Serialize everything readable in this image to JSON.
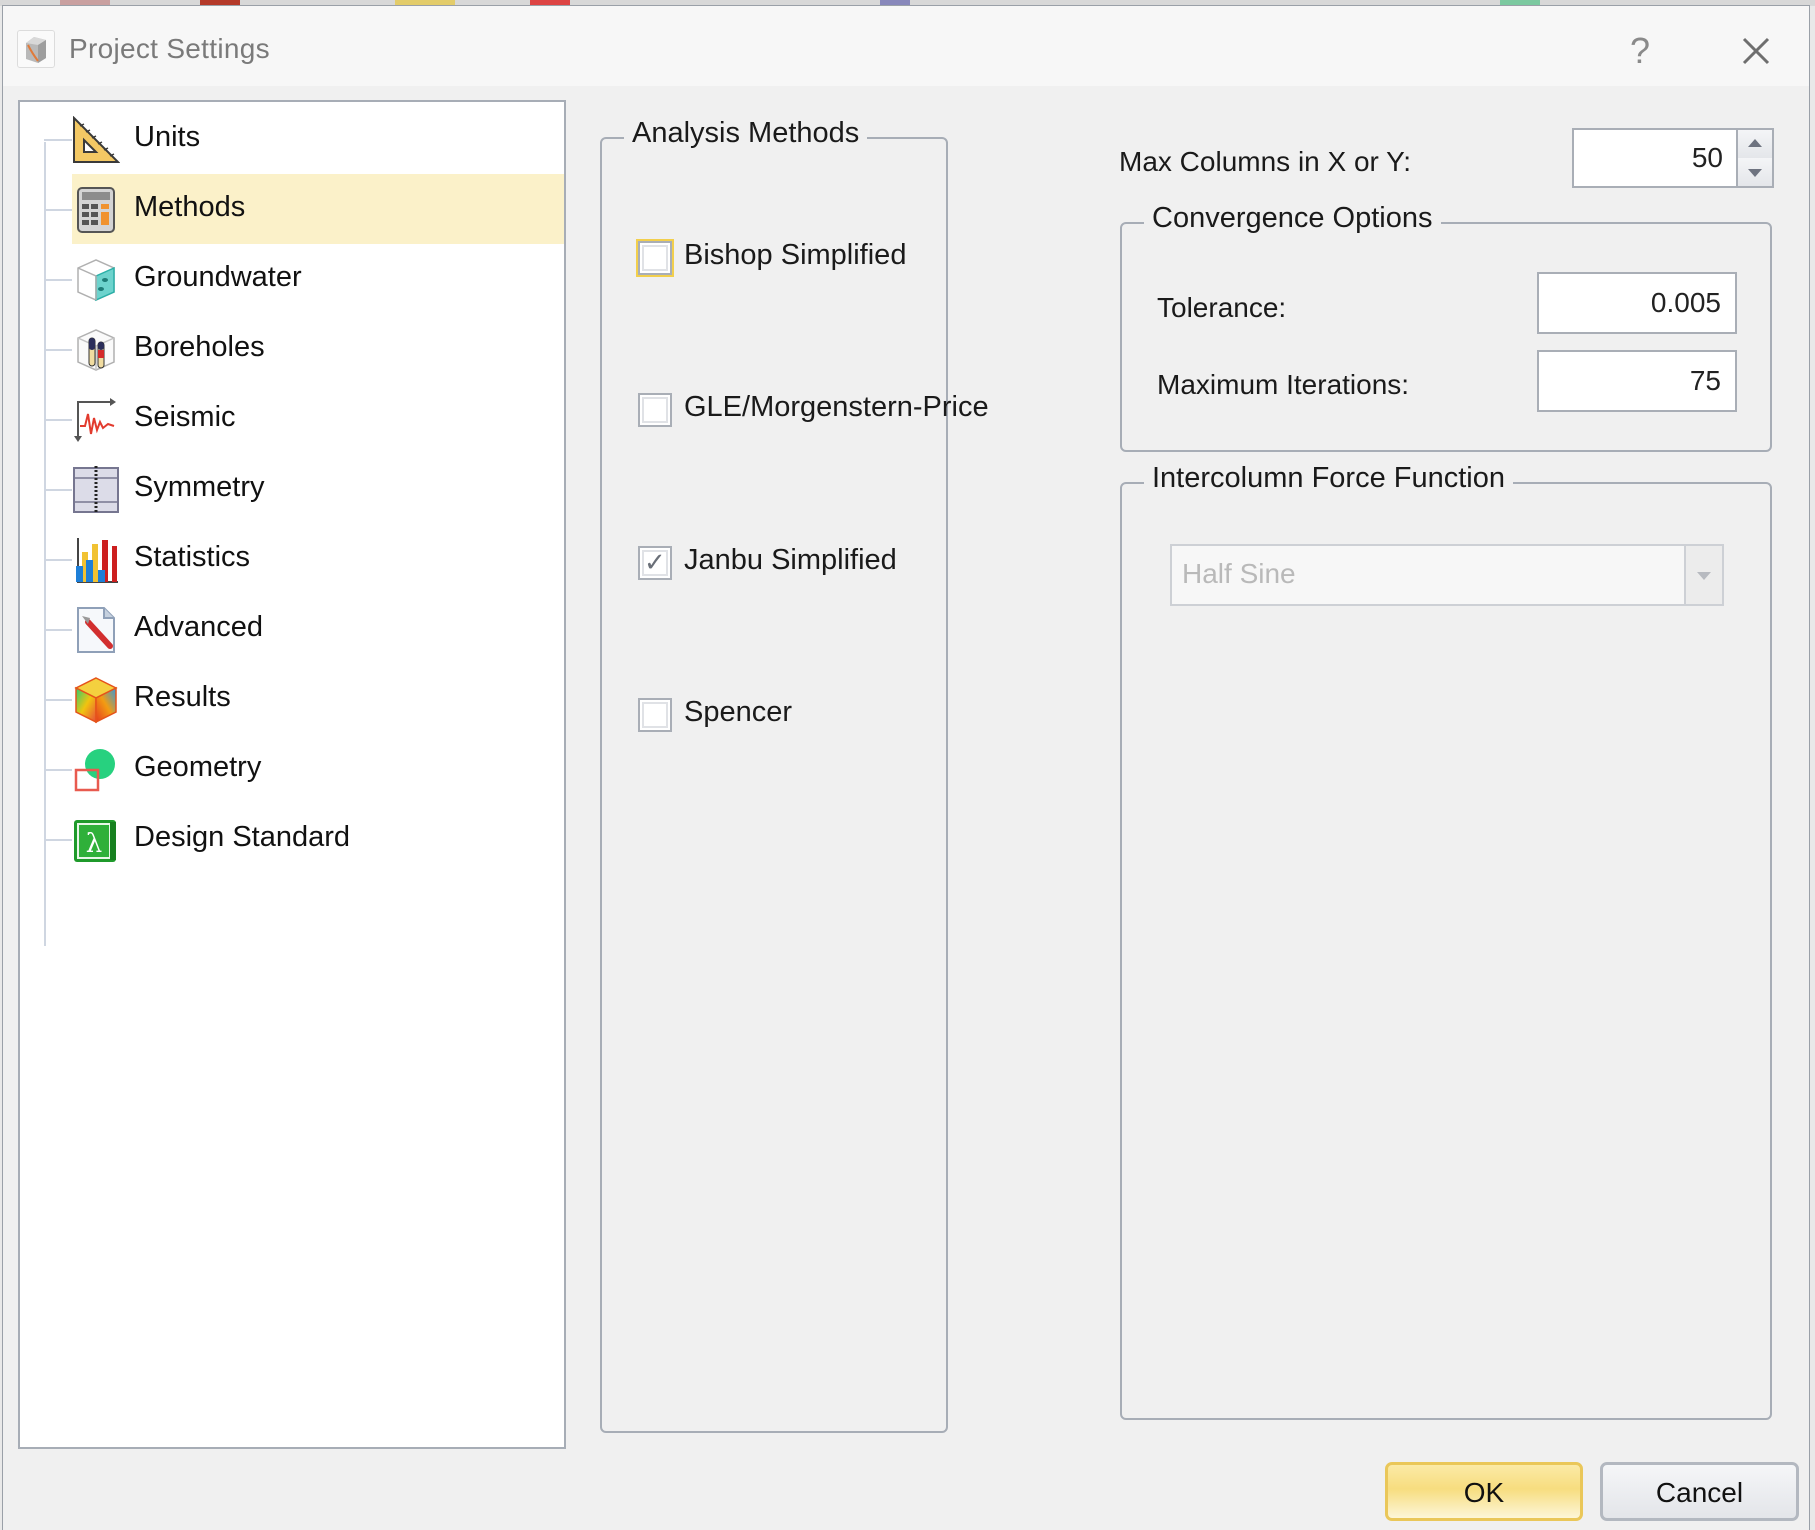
{
  "window": {
    "title": "Project Settings",
    "help_label": "?",
    "icons": {
      "app": "project-settings-icon",
      "help": "help-icon",
      "close": "close-icon"
    }
  },
  "sidebar": {
    "selected": "Methods",
    "items": [
      {
        "label": "Units",
        "icon": "set-square-ruler-icon"
      },
      {
        "label": "Methods",
        "icon": "calculator-icon"
      },
      {
        "label": "Groundwater",
        "icon": "water-cube-icon"
      },
      {
        "label": "Boreholes",
        "icon": "borehole-cube-icon"
      },
      {
        "label": "Seismic",
        "icon": "seismic-wave-icon"
      },
      {
        "label": "Symmetry",
        "icon": "symmetry-icon"
      },
      {
        "label": "Statistics",
        "icon": "bar-chart-icon"
      },
      {
        "label": "Advanced",
        "icon": "wrench-document-icon"
      },
      {
        "label": "Results",
        "icon": "results-cube-icon"
      },
      {
        "label": "Geometry",
        "icon": "geometry-shapes-icon"
      },
      {
        "label": "Design Standard",
        "icon": "lambda-book-icon"
      }
    ]
  },
  "analysis_methods": {
    "title": "Analysis Methods",
    "options": [
      {
        "label": "Bishop Simplified",
        "checked": false,
        "focused": true
      },
      {
        "label": "GLE/Morgenstern-Price",
        "checked": false,
        "focused": false
      },
      {
        "label": "Janbu Simplified",
        "checked": true,
        "focused": false
      },
      {
        "label": "Spencer",
        "checked": false,
        "focused": false
      }
    ],
    "check_glyph": "✓"
  },
  "max_columns": {
    "label": "Max Columns in X or Y:",
    "value": "50"
  },
  "convergence": {
    "title": "Convergence Options",
    "tolerance_label": "Tolerance:",
    "tolerance_value": "0.005",
    "max_iterations_label": "Maximum Iterations:",
    "max_iterations_value": "75"
  },
  "intercolumn": {
    "title": "Intercolumn Force Function",
    "selected": "Half Sine",
    "disabled": true
  },
  "buttons": {
    "ok": "OK",
    "cancel": "Cancel"
  },
  "colors": {
    "selection": "#fbf1c9",
    "ok_border": "#eac759",
    "focus": "#f2cf4c"
  }
}
